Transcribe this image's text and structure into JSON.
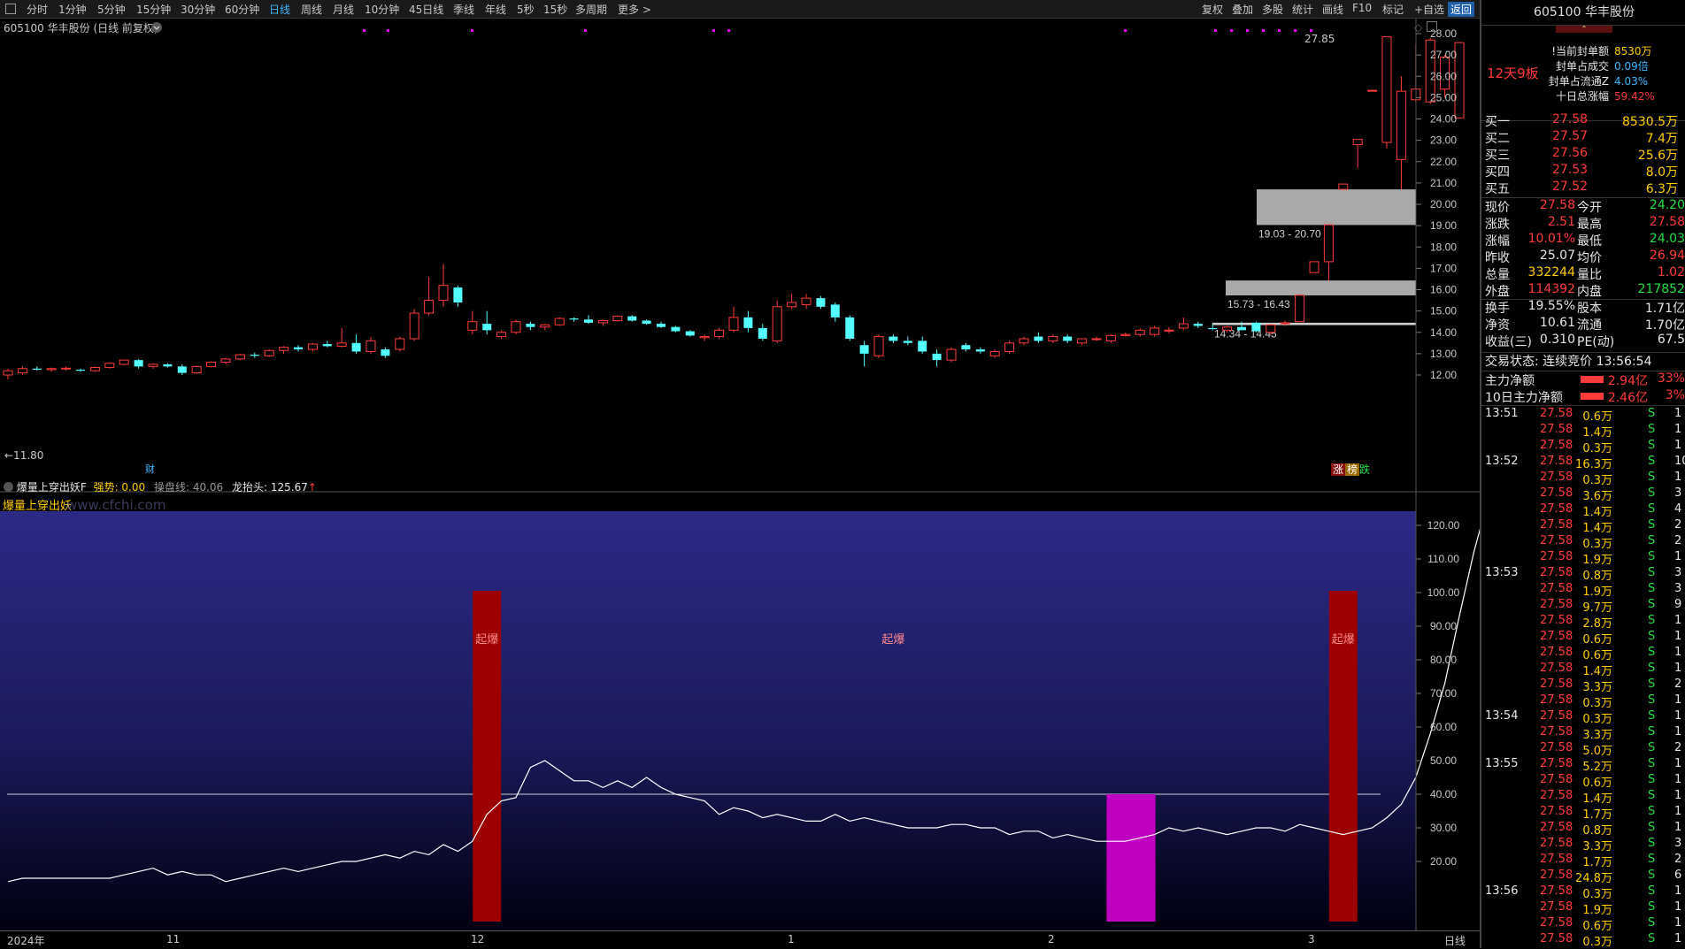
{
  "toolbar": {
    "periods": [
      "分时",
      "1分钟",
      "5分钟",
      "15分钟",
      "30分钟",
      "60分钟",
      "日线",
      "周线",
      "月线",
      "10分钟",
      "45日线",
      "季线",
      "年线",
      "5秒",
      "15秒",
      "多周期",
      "更多 >"
    ],
    "active_period": "日线",
    "right_tools": [
      "复权",
      "叠加",
      "多股",
      "统计",
      "画线",
      "F10",
      "标记",
      "+自选",
      "返回"
    ]
  },
  "chart_title": "605100 华丰股份 (日线 前复权)",
  "ohlc_label_high": "27.85",
  "low_marker": "←11.80",
  "cai_marker": "财",
  "zones": [
    {
      "label": "19.03 - 20.70",
      "low": 19.03,
      "high": 20.7
    },
    {
      "label": "15.73 - 16.43",
      "low": 15.73,
      "high": 16.43
    },
    {
      "label": "14.34 - 14.45",
      "low": 14.34,
      "high": 14.45
    }
  ],
  "price_axis": [
    "28.00",
    "27.00",
    "26.00",
    "25.00",
    "24.00",
    "23.00",
    "22.00",
    "21.00",
    "20.00",
    "19.00",
    "18.00",
    "17.00",
    "16.00",
    "15.00",
    "14.00",
    "13.00",
    "12.00"
  ],
  "zhang_die": {
    "zhang": "涨",
    "bang": "榜",
    "die": "跌"
  },
  "indicator": {
    "name": "爆量上穿出妖F",
    "strength_label": "强势: 0.00",
    "fugang_label": "操盘线: 40.06",
    "dragon_label": "龙抬头: 125.67",
    "inner_title": "爆量上穿出妖",
    "watermark": "www.cfchi.com",
    "axis": [
      "120.00",
      "110.00",
      "100.00",
      "90.00",
      "80.00",
      "70.00",
      "60.00",
      "50.00",
      "40.00",
      "30.00",
      "20.00"
    ],
    "signal_text": "起爆",
    "threshold": 40
  },
  "x_axis": [
    "2024年",
    "11",
    "12",
    "1",
    "2",
    "3"
  ],
  "x_axis_right": "日线",
  "chart_data": {
    "type": "candlestick",
    "ylim": [
      11.6,
      28.2
    ],
    "candles": [
      {
        "o": 12.0,
        "h": 12.3,
        "l": 11.8,
        "c": 12.2
      },
      {
        "o": 12.1,
        "h": 12.4,
        "l": 12.0,
        "c": 12.3
      },
      {
        "o": 12.3,
        "h": 12.4,
        "l": 12.2,
        "c": 12.25
      },
      {
        "o": 12.25,
        "h": 12.35,
        "l": 12.15,
        "c": 12.3
      },
      {
        "o": 12.3,
        "h": 12.4,
        "l": 12.2,
        "c": 12.32
      },
      {
        "o": 12.25,
        "h": 12.3,
        "l": 12.15,
        "c": 12.2
      },
      {
        "o": 12.2,
        "h": 12.4,
        "l": 12.15,
        "c": 12.35
      },
      {
        "o": 12.35,
        "h": 12.6,
        "l": 12.3,
        "c": 12.55
      },
      {
        "o": 12.5,
        "h": 12.7,
        "l": 12.45,
        "c": 12.7
      },
      {
        "o": 12.7,
        "h": 12.75,
        "l": 12.3,
        "c": 12.4
      },
      {
        "o": 12.4,
        "h": 12.55,
        "l": 12.3,
        "c": 12.5
      },
      {
        "o": 12.5,
        "h": 12.55,
        "l": 12.35,
        "c": 12.4
      },
      {
        "o": 12.4,
        "h": 12.5,
        "l": 12.0,
        "c": 12.1
      },
      {
        "o": 12.1,
        "h": 12.45,
        "l": 12.05,
        "c": 12.4
      },
      {
        "o": 12.4,
        "h": 12.65,
        "l": 12.35,
        "c": 12.6
      },
      {
        "o": 12.6,
        "h": 12.8,
        "l": 12.5,
        "c": 12.75
      },
      {
        "o": 12.75,
        "h": 13.0,
        "l": 12.7,
        "c": 12.95
      },
      {
        "o": 12.95,
        "h": 13.05,
        "l": 12.8,
        "c": 12.9
      },
      {
        "o": 12.9,
        "h": 13.2,
        "l": 12.85,
        "c": 13.15
      },
      {
        "o": 13.15,
        "h": 13.35,
        "l": 13.0,
        "c": 13.3
      },
      {
        "o": 13.3,
        "h": 13.4,
        "l": 13.1,
        "c": 13.2
      },
      {
        "o": 13.2,
        "h": 13.5,
        "l": 13.1,
        "c": 13.45
      },
      {
        "o": 13.45,
        "h": 13.6,
        "l": 13.3,
        "c": 13.35
      },
      {
        "o": 13.35,
        "h": 14.2,
        "l": 13.3,
        "c": 13.5
      },
      {
        "o": 13.5,
        "h": 13.9,
        "l": 13.0,
        "c": 13.1
      },
      {
        "o": 13.1,
        "h": 13.8,
        "l": 13.0,
        "c": 13.6
      },
      {
        "o": 13.2,
        "h": 13.3,
        "l": 12.8,
        "c": 12.9
      },
      {
        "o": 13.2,
        "h": 13.8,
        "l": 13.1,
        "c": 13.7
      },
      {
        "o": 13.7,
        "h": 15.1,
        "l": 13.6,
        "c": 14.9
      },
      {
        "o": 14.9,
        "h": 16.6,
        "l": 14.8,
        "c": 15.5
      },
      {
        "o": 15.5,
        "h": 17.2,
        "l": 15.2,
        "c": 16.2
      },
      {
        "o": 16.1,
        "h": 16.2,
        "l": 15.2,
        "c": 15.4
      },
      {
        "o": 14.1,
        "h": 15.0,
        "l": 13.9,
        "c": 14.5
      },
      {
        "o": 14.4,
        "h": 15.0,
        "l": 13.9,
        "c": 14.1
      },
      {
        "o": 13.8,
        "h": 14.1,
        "l": 13.7,
        "c": 14.0
      },
      {
        "o": 14.0,
        "h": 14.6,
        "l": 13.9,
        "c": 14.5
      },
      {
        "o": 14.4,
        "h": 14.5,
        "l": 14.1,
        "c": 14.25
      },
      {
        "o": 14.25,
        "h": 14.4,
        "l": 14.1,
        "c": 14.35
      },
      {
        "o": 14.35,
        "h": 14.7,
        "l": 14.3,
        "c": 14.65
      },
      {
        "o": 14.65,
        "h": 14.7,
        "l": 14.5,
        "c": 14.6
      },
      {
        "o": 14.6,
        "h": 14.8,
        "l": 14.4,
        "c": 14.45
      },
      {
        "o": 14.45,
        "h": 14.6,
        "l": 14.3,
        "c": 14.55
      },
      {
        "o": 14.55,
        "h": 14.8,
        "l": 14.5,
        "c": 14.75
      },
      {
        "o": 14.75,
        "h": 14.8,
        "l": 14.5,
        "c": 14.55
      },
      {
        "o": 14.55,
        "h": 14.6,
        "l": 14.35,
        "c": 14.4
      },
      {
        "o": 14.4,
        "h": 14.5,
        "l": 14.2,
        "c": 14.25
      },
      {
        "o": 14.25,
        "h": 14.3,
        "l": 14.0,
        "c": 14.05
      },
      {
        "o": 14.05,
        "h": 14.1,
        "l": 13.8,
        "c": 13.85
      },
      {
        "o": 13.75,
        "h": 13.9,
        "l": 13.6,
        "c": 13.8
      },
      {
        "o": 13.8,
        "h": 14.2,
        "l": 13.7,
        "c": 14.1
      },
      {
        "o": 14.1,
        "h": 15.2,
        "l": 14.0,
        "c": 14.7
      },
      {
        "o": 14.7,
        "h": 15.0,
        "l": 14.0,
        "c": 14.2
      },
      {
        "o": 14.2,
        "h": 14.4,
        "l": 13.6,
        "c": 13.7
      },
      {
        "o": 13.6,
        "h": 15.5,
        "l": 13.5,
        "c": 15.2
      },
      {
        "o": 15.2,
        "h": 15.8,
        "l": 15.1,
        "c": 15.4
      },
      {
        "o": 15.3,
        "h": 15.8,
        "l": 15.1,
        "c": 15.6
      },
      {
        "o": 15.6,
        "h": 15.7,
        "l": 15.1,
        "c": 15.2
      },
      {
        "o": 15.3,
        "h": 15.4,
        "l": 14.5,
        "c": 14.7
      },
      {
        "o": 14.7,
        "h": 14.8,
        "l": 13.6,
        "c": 13.7
      },
      {
        "o": 13.4,
        "h": 13.6,
        "l": 12.4,
        "c": 13.0
      },
      {
        "o": 12.9,
        "h": 13.9,
        "l": 12.8,
        "c": 13.8
      },
      {
        "o": 13.8,
        "h": 13.9,
        "l": 13.5,
        "c": 13.6
      },
      {
        "o": 13.6,
        "h": 13.8,
        "l": 13.4,
        "c": 13.5
      },
      {
        "o": 13.6,
        "h": 13.8,
        "l": 13.0,
        "c": 13.1
      },
      {
        "o": 13.0,
        "h": 13.2,
        "l": 12.4,
        "c": 12.7
      },
      {
        "o": 12.7,
        "h": 13.3,
        "l": 12.6,
        "c": 13.2
      },
      {
        "o": 13.4,
        "h": 13.5,
        "l": 13.1,
        "c": 13.2
      },
      {
        "o": 13.2,
        "h": 13.3,
        "l": 13.0,
        "c": 13.1
      },
      {
        "o": 12.9,
        "h": 13.2,
        "l": 12.8,
        "c": 13.1
      },
      {
        "o": 13.1,
        "h": 13.6,
        "l": 13.0,
        "c": 13.5
      },
      {
        "o": 13.5,
        "h": 13.8,
        "l": 13.4,
        "c": 13.7
      },
      {
        "o": 13.8,
        "h": 14.0,
        "l": 13.5,
        "c": 13.6
      },
      {
        "o": 13.6,
        "h": 13.9,
        "l": 13.5,
        "c": 13.8
      },
      {
        "o": 13.8,
        "h": 13.9,
        "l": 13.5,
        "c": 13.6
      },
      {
        "o": 13.5,
        "h": 13.7,
        "l": 13.4,
        "c": 13.7
      },
      {
        "o": 13.7,
        "h": 13.8,
        "l": 13.6,
        "c": 13.7
      },
      {
        "o": 13.6,
        "h": 13.9,
        "l": 13.5,
        "c": 13.85
      },
      {
        "o": 13.85,
        "h": 14.0,
        "l": 13.8,
        "c": 13.9
      },
      {
        "o": 13.9,
        "h": 14.2,
        "l": 13.8,
        "c": 14.1
      },
      {
        "o": 13.9,
        "h": 14.3,
        "l": 13.8,
        "c": 14.2
      },
      {
        "o": 14.1,
        "h": 14.25,
        "l": 13.95,
        "c": 14.1
      },
      {
        "o": 14.2,
        "h": 14.7,
        "l": 14.1,
        "c": 14.4
      },
      {
        "o": 14.4,
        "h": 14.5,
        "l": 14.2,
        "c": 14.3
      },
      {
        "o": 14.2,
        "h": 14.4,
        "l": 14.1,
        "c": 14.15
      },
      {
        "o": 14.1,
        "h": 14.3,
        "l": 14.0,
        "c": 14.25
      },
      {
        "o": 14.25,
        "h": 14.5,
        "l": 14.1,
        "c": 14.1
      },
      {
        "o": 14.45,
        "h": 14.5,
        "l": 14.0,
        "c": 14.05
      },
      {
        "o": 14.0,
        "h": 14.4,
        "l": 13.9,
        "c": 14.35
      },
      {
        "o": 14.4,
        "h": 14.55,
        "l": 14.3,
        "c": 14.45
      },
      {
        "o": 14.5,
        "h": 15.8,
        "l": 14.5,
        "c": 15.74
      },
      {
        "o": 16.8,
        "h": 17.31,
        "l": 16.8,
        "c": 17.31
      },
      {
        "o": 17.31,
        "h": 19.05,
        "l": 16.43,
        "c": 19.04
      },
      {
        "o": 20.7,
        "h": 20.95,
        "l": 20.7,
        "c": 20.95
      },
      {
        "o": 22.8,
        "h": 23.04,
        "l": 21.7,
        "c": 23.04
      },
      {
        "o": 25.3,
        "h": 25.35,
        "l": 25.3,
        "c": 25.34
      },
      {
        "o": 22.9,
        "h": 27.85,
        "l": 22.6,
        "c": 27.85
      },
      {
        "o": 22.1,
        "h": 26.0,
        "l": 20.7,
        "c": 25.3
      },
      {
        "o": 24.9,
        "h": 27.5,
        "l": 24.8,
        "c": 25.4
      },
      {
        "o": 24.8,
        "h": 27.8,
        "l": 24.7,
        "c": 27.7
      },
      {
        "o": 25.4,
        "h": 27.0,
        "l": 25.0,
        "c": 26.9
      },
      {
        "o": 24.05,
        "h": 27.6,
        "l": 24.05,
        "c": 27.58
      }
    ],
    "indicator_line": [
      14,
      15,
      15,
      15,
      15,
      15,
      15,
      15,
      16,
      17,
      18,
      16,
      17,
      16,
      16,
      14,
      15,
      16,
      17,
      18,
      17,
      18,
      19,
      20,
      20,
      21,
      22,
      21,
      23,
      22,
      25,
      23,
      26,
      34,
      38,
      39,
      48,
      50,
      47,
      44,
      44,
      42,
      44,
      42,
      45,
      42,
      40,
      39,
      38,
      34,
      36,
      35,
      33,
      34,
      33,
      32,
      32,
      34,
      32,
      33,
      32,
      31,
      30,
      30,
      30,
      31,
      31,
      30,
      30,
      28,
      29,
      29,
      27,
      28,
      27,
      26,
      26,
      26,
      27,
      28,
      30,
      29,
      30,
      29,
      28,
      29,
      30,
      30,
      29,
      31,
      30,
      29,
      28,
      29,
      30,
      33,
      37,
      45,
      58,
      73,
      93,
      112,
      128,
      107,
      125,
      128,
      100,
      122
    ],
    "signals": [
      {
        "index": 33,
        "type": "qibao"
      },
      {
        "index": 61,
        "type": "label_only"
      },
      {
        "index": 92,
        "type": "qibao"
      }
    ],
    "magenta_block": {
      "start_index": 76,
      "end_index": 79
    }
  },
  "stock": {
    "code": "605100",
    "name": "华丰股份",
    "streak": "12天9板",
    "info_rows": [
      {
        "label": "!当前封单额",
        "value": "8530万"
      },
      {
        "label": "封单占成交",
        "value": "0.09倍"
      },
      {
        "label": "封单占流通Z",
        "value": "4.03%"
      },
      {
        "label": "十日总涨幅",
        "value": "59.42%"
      }
    ]
  },
  "order_book": [
    {
      "label": "买一",
      "price": "27.58",
      "vol": "8530.5万"
    },
    {
      "label": "买二",
      "price": "27.57",
      "vol": "7.4万"
    },
    {
      "label": "买三",
      "price": "27.56",
      "vol": "25.6万"
    },
    {
      "label": "买四",
      "price": "27.53",
      "vol": "8.0万"
    },
    {
      "label": "买五",
      "price": "27.52",
      "vol": "6.3万"
    }
  ],
  "quotes": [
    {
      "l1": "现价",
      "v1": "27.58",
      "l2": "今开",
      "v2": "24.20"
    },
    {
      "l1": "涨跌",
      "v1": "2.51",
      "l2": "最高",
      "v2": "27.58"
    },
    {
      "l1": "涨幅",
      "v1": "10.01%",
      "l2": "最低",
      "v2": "24.03"
    },
    {
      "l1": "昨收",
      "v1": "25.07",
      "l2": "均价",
      "v2": "26.94"
    },
    {
      "l1": "总量",
      "v1": "332244",
      "l2": "量比",
      "v2": "1.02"
    },
    {
      "l1": "外盘",
      "v1": "114392",
      "l2": "内盘",
      "v2": "217852"
    },
    {
      "l1": "换手",
      "v1": "19.55%",
      "l2": "股本",
      "v2": "1.71亿"
    },
    {
      "l1": "净资",
      "v1": "10.61",
      "l2": "流通",
      "v2": "1.70亿"
    },
    {
      "l1": "收益(三)",
      "v1": "0.310",
      "l2": "PE(动)",
      "v2": "67.5"
    }
  ],
  "trade_state": "交易状态: 连续竞价 13:56:54",
  "fund_flow": [
    {
      "label": "主力净额",
      "value": "2.94亿",
      "pct": "33%"
    },
    {
      "label": "10日主力净额",
      "value": "2.46亿",
      "pct": "3%"
    }
  ],
  "ticks": [
    {
      "t": "13:51",
      "p": "27.58",
      "v": "0.6万",
      "s": "S",
      "n": "1"
    },
    {
      "t": "",
      "p": "27.58",
      "v": "1.4万",
      "s": "S",
      "n": "1"
    },
    {
      "t": "",
      "p": "27.58",
      "v": "0.3万",
      "s": "S",
      "n": "1"
    },
    {
      "t": "13:52",
      "p": "27.58",
      "v": "16.3万",
      "s": "S",
      "n": "10"
    },
    {
      "t": "",
      "p": "27.58",
      "v": "0.3万",
      "s": "S",
      "n": "1"
    },
    {
      "t": "",
      "p": "27.58",
      "v": "3.6万",
      "s": "S",
      "n": "3"
    },
    {
      "t": "",
      "p": "27.58",
      "v": "1.4万",
      "s": "S",
      "n": "4"
    },
    {
      "t": "",
      "p": "27.58",
      "v": "1.4万",
      "s": "S",
      "n": "2"
    },
    {
      "t": "",
      "p": "27.58",
      "v": "0.3万",
      "s": "S",
      "n": "2"
    },
    {
      "t": "",
      "p": "27.58",
      "v": "1.9万",
      "s": "S",
      "n": "1"
    },
    {
      "t": "13:53",
      "p": "27.58",
      "v": "0.8万",
      "s": "S",
      "n": "3"
    },
    {
      "t": "",
      "p": "27.58",
      "v": "1.9万",
      "s": "S",
      "n": "3"
    },
    {
      "t": "",
      "p": "27.58",
      "v": "9.7万",
      "s": "S",
      "n": "9"
    },
    {
      "t": "",
      "p": "27.58",
      "v": "2.8万",
      "s": "S",
      "n": "1"
    },
    {
      "t": "",
      "p": "27.58",
      "v": "0.6万",
      "s": "S",
      "n": "1"
    },
    {
      "t": "",
      "p": "27.58",
      "v": "0.6万",
      "s": "S",
      "n": "1"
    },
    {
      "t": "",
      "p": "27.58",
      "v": "1.4万",
      "s": "S",
      "n": "1"
    },
    {
      "t": "",
      "p": "27.58",
      "v": "3.3万",
      "s": "S",
      "n": "2"
    },
    {
      "t": "",
      "p": "27.58",
      "v": "0.3万",
      "s": "S",
      "n": "1"
    },
    {
      "t": "13:54",
      "p": "27.58",
      "v": "0.3万",
      "s": "S",
      "n": "1"
    },
    {
      "t": "",
      "p": "27.58",
      "v": "3.3万",
      "s": "S",
      "n": "1"
    },
    {
      "t": "",
      "p": "27.58",
      "v": "5.0万",
      "s": "S",
      "n": "2"
    },
    {
      "t": "13:55",
      "p": "27.58",
      "v": "5.2万",
      "s": "S",
      "n": "1"
    },
    {
      "t": "",
      "p": "27.58",
      "v": "0.6万",
      "s": "S",
      "n": "1"
    },
    {
      "t": "",
      "p": "27.58",
      "v": "1.4万",
      "s": "S",
      "n": "1"
    },
    {
      "t": "",
      "p": "27.58",
      "v": "1.7万",
      "s": "S",
      "n": "1"
    },
    {
      "t": "",
      "p": "27.58",
      "v": "0.8万",
      "s": "S",
      "n": "1"
    },
    {
      "t": "",
      "p": "27.58",
      "v": "3.3万",
      "s": "S",
      "n": "3"
    },
    {
      "t": "",
      "p": "27.58",
      "v": "1.7万",
      "s": "S",
      "n": "2"
    },
    {
      "t": "",
      "p": "27.58",
      "v": "24.8万",
      "s": "S",
      "n": "6"
    },
    {
      "t": "13:56",
      "p": "27.58",
      "v": "0.3万",
      "s": "S",
      "n": "1"
    },
    {
      "t": "",
      "p": "27.58",
      "v": "1.9万",
      "s": "S",
      "n": "1"
    },
    {
      "t": "",
      "p": "27.58",
      "v": "0.6万",
      "s": "S",
      "n": "1"
    },
    {
      "t": "",
      "p": "27.58",
      "v": "0.3万",
      "s": "S",
      "n": "1"
    }
  ]
}
